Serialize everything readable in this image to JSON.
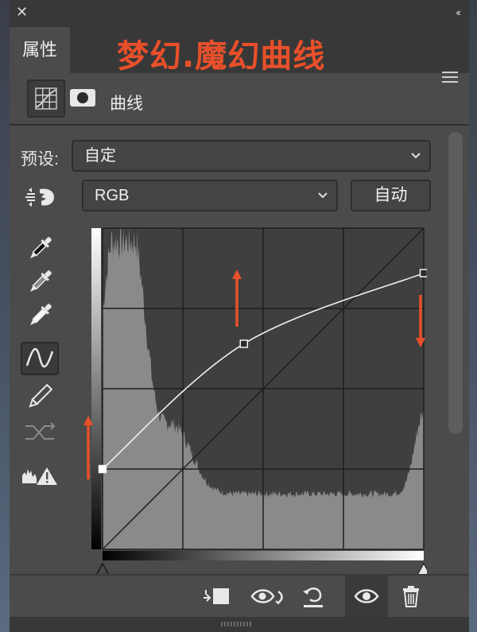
{
  "panel": {
    "tab_label": "属性",
    "overlay_title": "梦幻.魔幻曲线",
    "layer_name": "曲线"
  },
  "preset": {
    "label": "预设:",
    "value": "自定"
  },
  "channel": {
    "value": "RGB"
  },
  "auto_button": "自动",
  "curve_points": [
    {
      "input": 0,
      "output": 25
    },
    {
      "input": 44,
      "output": 64
    },
    {
      "input": 100,
      "output": 86
    }
  ],
  "colors": {
    "panel_bg": "#4b4b4b",
    "title_accent": "#e8502a",
    "arrow": "#e8502a",
    "curve_line": "#f0f0f0",
    "histogram": "#8a8a8a",
    "graph_bg": "#3f3f3f"
  },
  "icons": {
    "close": "close-icon",
    "collapse": "double-chevron-left-icon",
    "menu": "hamburger-menu-icon",
    "adjustment": "curves-adjustment-icon",
    "mask": "layer-mask-icon",
    "target_adjust": "on-image-adjust-hand-icon",
    "eyedropper_black": "eyedropper-black-icon",
    "eyedropper_gray": "eyedropper-gray-icon",
    "eyedropper_white": "eyedropper-white-icon",
    "curve_tool": "curve-point-tool-icon",
    "pencil_tool": "pencil-draw-icon",
    "smooth": "smooth-curve-icon",
    "clipping_warning": "clipping-warning-icon",
    "clip_to_layer": "clip-to-layer-icon",
    "view_previous": "view-previous-state-icon",
    "reset": "reset-icon",
    "visibility": "eye-visibility-icon",
    "delete": "trash-icon"
  }
}
